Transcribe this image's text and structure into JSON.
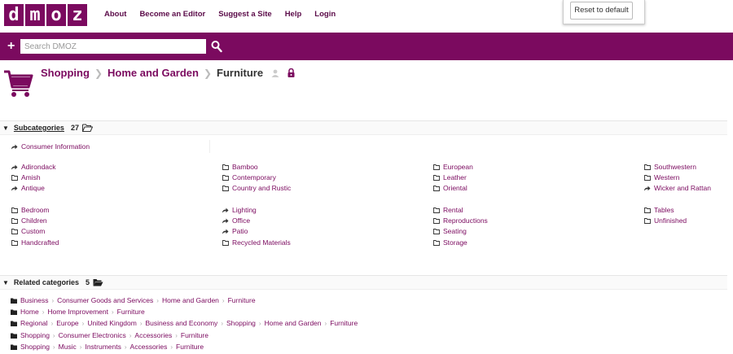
{
  "logo": [
    "d",
    "m",
    "o",
    "z"
  ],
  "topnav": [
    "About",
    "Become an Editor",
    "Suggest a Site",
    "Help",
    "Login"
  ],
  "reset_label": "Reset to default",
  "search": {
    "placeholder": "Search DMOZ"
  },
  "breadcrumb": {
    "items": [
      "Shopping",
      "Home and Garden"
    ],
    "current": "Furniture"
  },
  "subcategories": {
    "title": "Subcategories",
    "count": "27",
    "top_item": {
      "label": "Consumer Information",
      "type": "link"
    },
    "columns": [
      [
        [
          {
            "label": "Adirondack",
            "type": "link"
          },
          {
            "label": "Amish",
            "type": "folder"
          },
          {
            "label": "Antique",
            "type": "link"
          }
        ],
        [
          {
            "label": "Bedroom",
            "type": "folder"
          },
          {
            "label": "Children",
            "type": "folder"
          },
          {
            "label": "Custom",
            "type": "folder"
          },
          {
            "label": "Handcrafted",
            "type": "folder"
          }
        ]
      ],
      [
        [
          {
            "label": "Bamboo",
            "type": "folder"
          },
          {
            "label": "Contemporary",
            "type": "folder"
          },
          {
            "label": "Country and Rustic",
            "type": "folder"
          }
        ],
        [
          {
            "label": "Lighting",
            "type": "link"
          },
          {
            "label": "Office",
            "type": "link"
          },
          {
            "label": "Patio",
            "type": "link"
          },
          {
            "label": "Recycled Materials",
            "type": "folder"
          }
        ]
      ],
      [
        [
          {
            "label": "European",
            "type": "folder"
          },
          {
            "label": "Leather",
            "type": "folder"
          },
          {
            "label": "Oriental",
            "type": "folder"
          }
        ],
        [
          {
            "label": "Rental",
            "type": "folder"
          },
          {
            "label": "Reproductions",
            "type": "folder"
          },
          {
            "label": "Seating",
            "type": "folder"
          },
          {
            "label": "Storage",
            "type": "folder"
          }
        ]
      ],
      [
        [
          {
            "label": "Southwestern",
            "type": "folder"
          },
          {
            "label": "Western",
            "type": "folder"
          },
          {
            "label": "Wicker and Rattan",
            "type": "link"
          }
        ],
        [
          {
            "label": "Tables",
            "type": "folder"
          },
          {
            "label": "Unfinished",
            "type": "folder"
          }
        ]
      ]
    ]
  },
  "related": {
    "title": "Related categories",
    "count": "5",
    "paths": [
      [
        "Business",
        "Consumer Goods and Services",
        "Home and Garden",
        "Furniture"
      ],
      [
        "Home",
        "Home Improvement",
        "Furniture"
      ],
      [
        "Regional",
        "Europe",
        "United Kingdom",
        "Business and Economy",
        "Shopping",
        "Home and Garden",
        "Furniture"
      ],
      [
        "Shopping",
        "Consumer Electronics",
        "Accessories",
        "Furniture"
      ],
      [
        "Shopping",
        "Music",
        "Instruments",
        "Accessories",
        "Furniture"
      ]
    ]
  },
  "colors": {
    "brand": "#7b0a5f"
  }
}
